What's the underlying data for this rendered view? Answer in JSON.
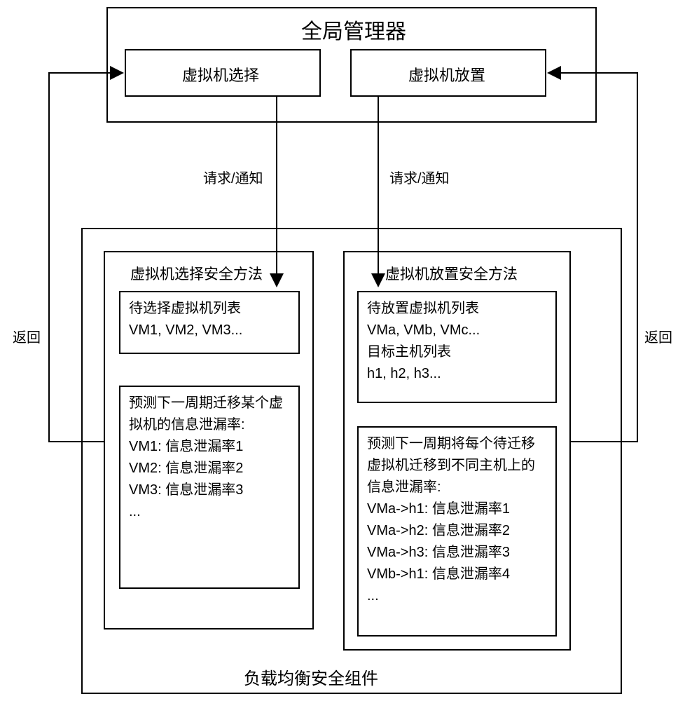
{
  "global_manager": {
    "title": "全局管理器",
    "vm_select_label": "虚拟机选择",
    "vm_place_label": "虚拟机放置"
  },
  "arrows": {
    "req_notify_left": "请求/通知",
    "req_notify_right": "请求/通知",
    "return_left": "返回",
    "return_right": "返回"
  },
  "security_component": {
    "title": "负载均衡安全组件",
    "select_method": {
      "title": "虚拟机选择安全方法",
      "pending_list": "待选择虚拟机列表\nVM1, VM2, VM3...",
      "predict": "预测下一周期迁移某个虚拟机的信息泄漏率:\nVM1: 信息泄漏率1\nVM2: 信息泄漏率2\nVM3: 信息泄漏率3\n..."
    },
    "place_method": {
      "title": "虚拟机放置安全方法",
      "pending_list": "待放置虚拟机列表\nVMa, VMb, VMc...\n目标主机列表\nh1, h2, h3...",
      "predict": "预测下一周期将每个待迁移虚拟机迁移到不同主机上的信息泄漏率:\nVMa->h1: 信息泄漏率1\nVMa->h2: 信息泄漏率2\nVMa->h3: 信息泄漏率3\nVMb->h1: 信息泄漏率4\n..."
    }
  }
}
